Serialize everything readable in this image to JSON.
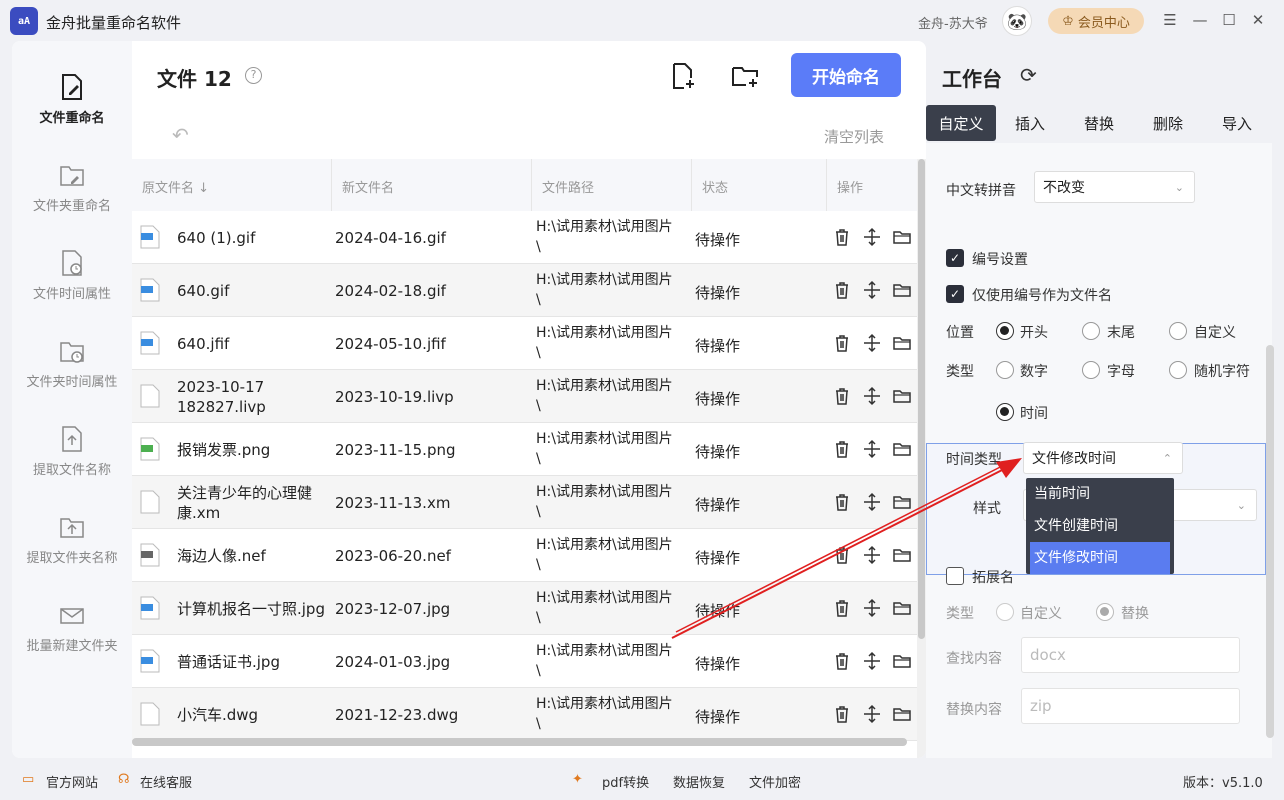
{
  "app": {
    "title": "金舟批量重命名软件",
    "user": "金舟-苏大爷",
    "vip_label": "会员中心",
    "logo_text": "aA"
  },
  "sidebar": {
    "items": [
      {
        "label": "文件重命名",
        "icon": "edit-file-icon",
        "active": true
      },
      {
        "label": "文件夹重命名",
        "icon": "edit-folder-icon",
        "active": false
      },
      {
        "label": "文件时间属性",
        "icon": "file-clock-icon",
        "active": false
      },
      {
        "label": "文件夹时间属性",
        "icon": "folder-clock-icon",
        "active": false
      },
      {
        "label": "提取文件名称",
        "icon": "extract-file-icon",
        "active": false
      },
      {
        "label": "提取文件夹名称",
        "icon": "extract-folder-icon",
        "active": false
      },
      {
        "label": "批量新建文件夹",
        "icon": "new-folder-batch-icon",
        "active": false
      }
    ]
  },
  "filelist": {
    "title": "文件 12",
    "start_button": "开始命名",
    "clear_label": "清空列表",
    "columns": [
      "原文件名",
      "新文件名",
      "文件路径",
      "状态",
      "操作"
    ],
    "rows": [
      {
        "orig": "640 (1).gif",
        "new": "2024-04-16.gif",
        "path": "H:\\试用素材\\试用图片\\",
        "status": "待操作",
        "icon": "gif-file-icon"
      },
      {
        "orig": "640.gif",
        "new": "2024-02-18.gif",
        "path": "H:\\试用素材\\试用图片\\",
        "status": "待操作",
        "icon": "gif-file-icon"
      },
      {
        "orig": "640.jfif",
        "new": "2024-05-10.jfif",
        "path": "H:\\试用素材\\试用图片\\",
        "status": "待操作",
        "icon": "jpg-file-icon"
      },
      {
        "orig": "2023-10-17 182827.livp",
        "new": "2023-10-19.livp",
        "path": "H:\\试用素材\\试用图片\\",
        "status": "待操作",
        "icon": "blank-file-icon"
      },
      {
        "orig": "报销发票.png",
        "new": "2023-11-15.png",
        "path": "H:\\试用素材\\试用图片\\",
        "status": "待操作",
        "icon": "png-file-icon"
      },
      {
        "orig": "关注青少年的心理健康.xm",
        "new": "2023-11-13.xm",
        "path": "H:\\试用素材\\试用图片\\",
        "status": "待操作",
        "icon": "blank-file-icon"
      },
      {
        "orig": "海边人像.nef",
        "new": "2023-06-20.nef",
        "path": "H:\\试用素材\\试用图片\\",
        "status": "待操作",
        "icon": "raw-file-icon"
      },
      {
        "orig": "计算机报名一寸照.jpg",
        "new": "2023-12-07.jpg",
        "path": "H:\\试用素材\\试用图片\\",
        "status": "待操作",
        "icon": "jpg-file-icon"
      },
      {
        "orig": "普通话证书.jpg",
        "new": "2024-01-03.jpg",
        "path": "H:\\试用素材\\试用图片\\",
        "status": "待操作",
        "icon": "jpg-file-icon"
      },
      {
        "orig": "小汽车.dwg",
        "new": "2021-12-23.dwg",
        "path": "H:\\试用素材\\试用图片\\",
        "status": "待操作",
        "icon": "blank-file-icon"
      }
    ]
  },
  "workbench": {
    "title": "工作台",
    "tabs": [
      {
        "label": "自定义",
        "active": true
      },
      {
        "label": "插入",
        "active": false
      },
      {
        "label": "替换",
        "active": false
      },
      {
        "label": "删除",
        "active": false
      },
      {
        "label": "导入",
        "active": false
      }
    ],
    "pinyin_label": "中文转拼音",
    "pinyin_value": "不改变",
    "numbering_label": "编号设置",
    "numbering_only_label": "仅使用编号作为文件名",
    "position_label": "位置",
    "position_options": [
      "开头",
      "末尾",
      "自定义"
    ],
    "type_label": "类型",
    "type_options": [
      "数字",
      "字母",
      "随机字符",
      "时间"
    ],
    "time_type_label": "时间类型",
    "time_type_value": "文件修改时间",
    "style_label": "样式",
    "time_type_options": [
      "当前时间",
      "文件创建时间",
      "文件修改时间"
    ],
    "ext_label": "拓展名",
    "ext_type_label": "类型",
    "ext_type_options": [
      "自定义",
      "替换"
    ],
    "find_label": "查找内容",
    "find_placeholder": "docx",
    "replace_label": "替换内容",
    "replace_placeholder": "zip"
  },
  "footer": {
    "website": "官方网站",
    "support": "在线客服",
    "pdf": "pdf转换",
    "recovery": "数据恢复",
    "encrypt": "文件加密",
    "version": "版本：v5.1.0"
  },
  "colors": {
    "accent": "#5b7cf8",
    "dark_tab": "#3a3f4b",
    "annotation_arrow": "#e02020"
  }
}
